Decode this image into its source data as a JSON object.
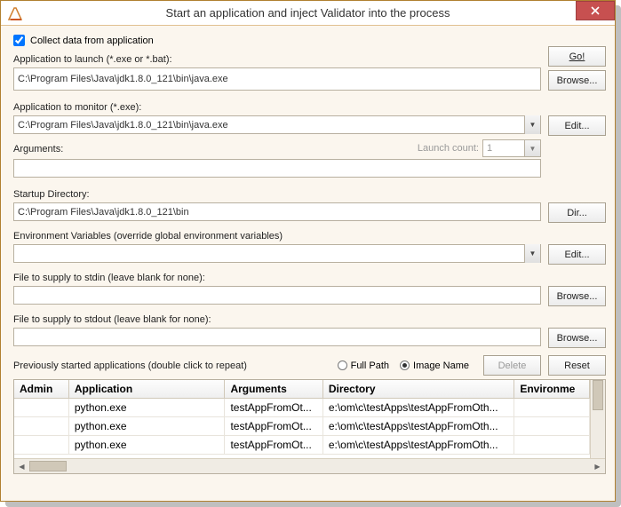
{
  "title": "Start an application and inject Validator into the process",
  "collect_checkbox": {
    "label": "Collect data from application",
    "checked": true
  },
  "launch": {
    "label": "Application to launch (*.exe or *.bat):",
    "value": "C:\\Program Files\\Java\\jdk1.8.0_121\\bin\\java.exe",
    "go": "Go!",
    "browse": "Browse..."
  },
  "monitor": {
    "label": "Application to monitor (*.exe):",
    "value": "C:\\Program Files\\Java\\jdk1.8.0_121\\bin\\java.exe",
    "edit": "Edit..."
  },
  "args": {
    "label": "Arguments:",
    "value": "",
    "launch_count_label": "Launch count:",
    "launch_count_value": "1"
  },
  "startup": {
    "label": "Startup Directory:",
    "value": "C:\\Program Files\\Java\\jdk1.8.0_121\\bin",
    "dir": "Dir..."
  },
  "env": {
    "label": "Environment Variables (override global environment variables)",
    "value": "",
    "edit": "Edit..."
  },
  "stdin": {
    "label": "File to supply to stdin (leave blank for none):",
    "value": "",
    "browse": "Browse..."
  },
  "stdout": {
    "label": "File to supply to stdout (leave blank for none):",
    "value": "",
    "browse": "Browse..."
  },
  "history": {
    "label": "Previously started applications (double click to repeat)",
    "full_path": "Full Path",
    "image_name": "Image Name",
    "selected": "image_name",
    "delete": "Delete",
    "reset": "Reset",
    "columns": [
      "Admin",
      "Application",
      "Arguments",
      "Directory",
      "Environme"
    ],
    "rows": [
      {
        "admin": "",
        "app": "python.exe",
        "args": "testAppFromOt...",
        "dir": "e:\\om\\c\\testApps\\testAppFromOth...",
        "env": ""
      },
      {
        "admin": "",
        "app": "python.exe",
        "args": "testAppFromOt...",
        "dir": "e:\\om\\c\\testApps\\testAppFromOth...",
        "env": ""
      },
      {
        "admin": "",
        "app": "python.exe",
        "args": "testAppFromOt...",
        "dir": "e:\\om\\c\\testApps\\testAppFromOth...",
        "env": ""
      }
    ]
  }
}
